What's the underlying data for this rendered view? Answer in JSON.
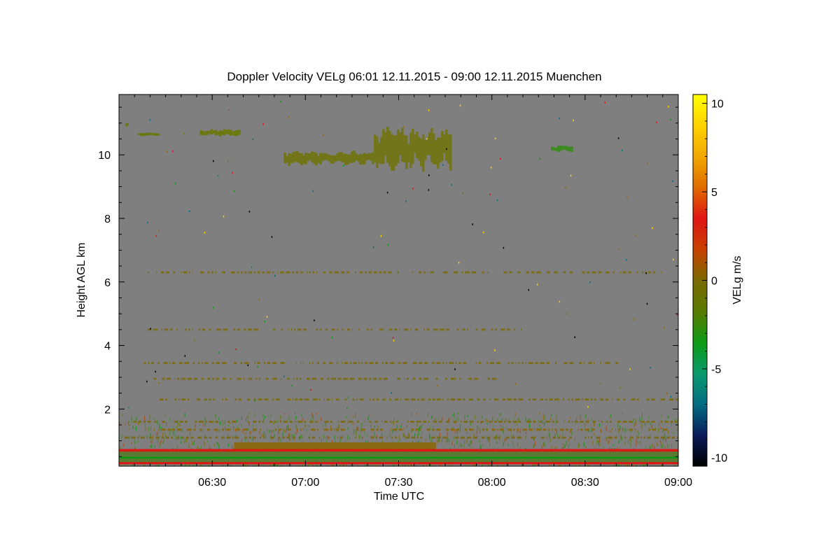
{
  "chart_data": {
    "type": "heatmap",
    "title": "Doppler Velocity VELg   06:01 12.11.2015 - 09:00 12.11.2015 Muenchen",
    "xlabel": "Time UTC",
    "ylabel": "Height AGL km",
    "colorbar_label": "VELg m/s",
    "x_ticks": [
      "06:30",
      "07:00",
      "07:30",
      "08:00",
      "08:30",
      "09:00"
    ],
    "x_tick_minutes": [
      30,
      60,
      90,
      120,
      150,
      180
    ],
    "xlim_minutes": [
      0,
      180
    ],
    "y_ticks": [
      "2",
      "4",
      "6",
      "8",
      "10"
    ],
    "y_tick_values": [
      2,
      4,
      6,
      8,
      10
    ],
    "ylim": [
      0.2,
      11.9
    ],
    "colorbar_ticks": [
      "10",
      "5",
      "0",
      "-5",
      "-10"
    ],
    "colorbar_tick_values": [
      10,
      5,
      0,
      -5,
      -10
    ],
    "clim": [
      -10.5,
      10.5
    ],
    "background_color": "#7f7f7f",
    "colormap": [
      "#000000",
      "#0a1c5a",
      "#046c82",
      "#0a9a6e",
      "#0c9a14",
      "#5a7a00",
      "#7a6a00",
      "#c84000",
      "#e01414",
      "#e06c00",
      "#f0a800",
      "#ffd200",
      "#ffff00"
    ],
    "features": [
      {
        "t": [
          82,
          107
        ],
        "h": [
          9.6,
          10.8
        ],
        "velocity": 0,
        "color": "#73751a"
      },
      {
        "t": [
          53,
          82
        ],
        "h": [
          9.7,
          10.1
        ],
        "velocity": 0,
        "color": "#717518"
      },
      {
        "t": [
          26,
          39
        ],
        "h": [
          10.6,
          10.8
        ],
        "velocity": 0,
        "color": "#6a7a10"
      },
      {
        "t": [
          6,
          13
        ],
        "h": [
          10.6,
          10.7
        ],
        "velocity": 0,
        "color": "#6a7a10"
      },
      {
        "t": [
          2,
          3
        ],
        "h": [
          10.9,
          11.0
        ],
        "velocity": 0,
        "color": "#6a7a10"
      },
      {
        "t": [
          139,
          146
        ],
        "h": [
          10.1,
          10.3
        ],
        "velocity": 0,
        "color": "#3c8a20"
      },
      {
        "t": [
          37,
          102
        ],
        "h": [
          0.7,
          0.95
        ],
        "velocity": 0,
        "color": "#8a6a10"
      },
      {
        "t": [
          0,
          180
        ],
        "h": [
          0.3,
          0.7
        ],
        "velocity": -1,
        "color": "#5a7a30"
      },
      {
        "t": [
          0,
          180
        ],
        "h": [
          0.66,
          0.74
        ],
        "velocity": 2,
        "color": "#e01414"
      },
      {
        "t": [
          0,
          180
        ],
        "h": [
          0.26,
          0.33
        ],
        "velocity": 2,
        "color": "#e01414"
      },
      {
        "t": [
          0,
          180
        ],
        "h": [
          0.44,
          0.5
        ],
        "velocity": -2,
        "color": "#0c9a14"
      }
    ],
    "layers": [
      {
        "h": 2.3,
        "t": [
          13,
          180
        ],
        "color": "#7c6e1a"
      },
      {
        "h": 2.95,
        "t": [
          10,
          122
        ],
        "color": "#7c6e1a"
      },
      {
        "h": 3.45,
        "t": [
          8,
          160
        ],
        "color": "#7c6e1a"
      },
      {
        "h": 1.6,
        "t": [
          4,
          180
        ],
        "color": "#7c6e1a"
      },
      {
        "h": 1.35,
        "t": [
          10,
          180
        ],
        "color": "#8a6a10"
      },
      {
        "h": 1.1,
        "t": [
          0,
          180
        ],
        "color": "#7a6a20"
      },
      {
        "h": 6.3,
        "t": [
          8,
          175
        ],
        "color": "#7c6e1a"
      },
      {
        "h": 4.5,
        "t": [
          8,
          130
        ],
        "color": "#7c6e1a"
      }
    ]
  }
}
